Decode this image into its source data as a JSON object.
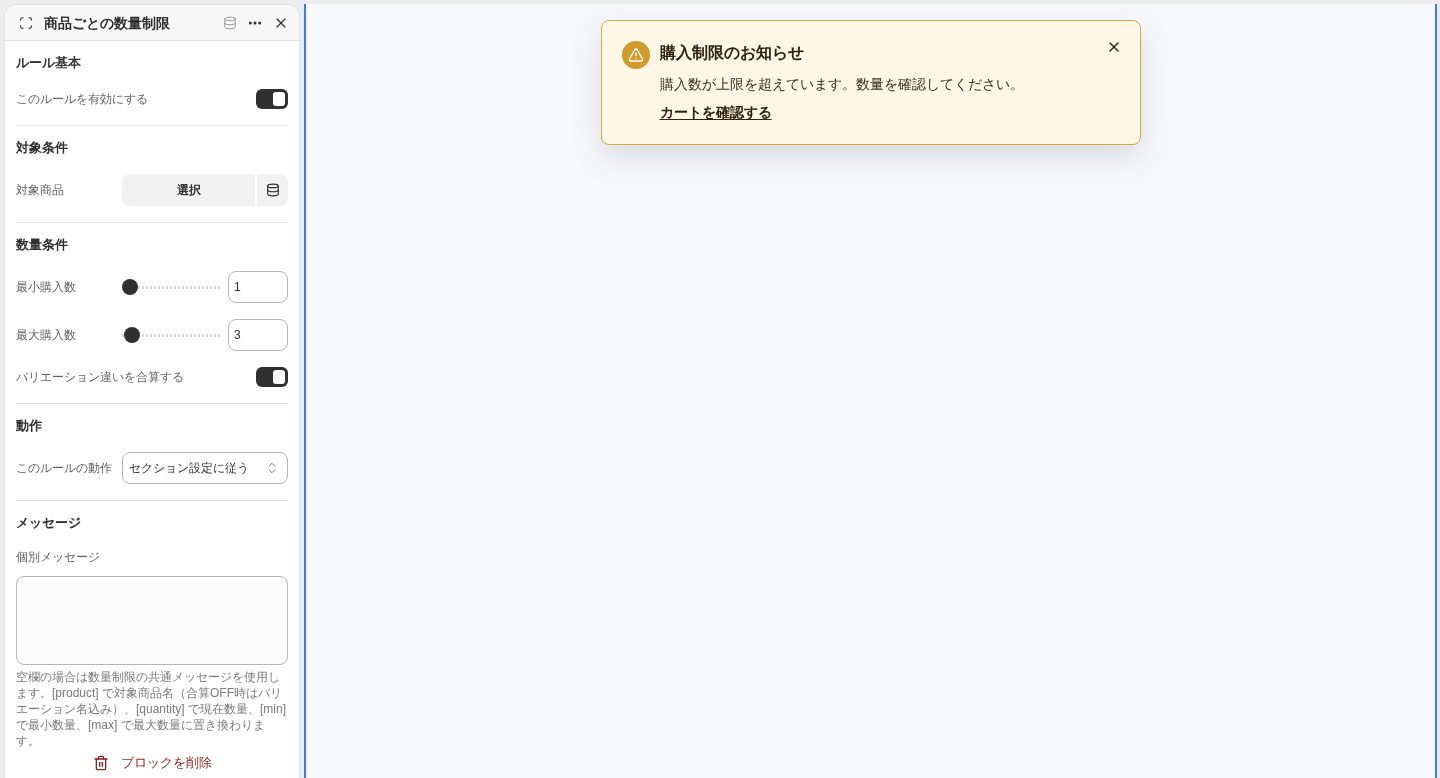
{
  "panel": {
    "title": "商品ごとの数量制限",
    "sections": [
      {
        "heading": "ルール基本",
        "rows": [
          {
            "kind": "toggle",
            "label": "このルールを有効にする",
            "on": true
          }
        ]
      },
      {
        "heading": "対象条件",
        "rows": [
          {
            "kind": "picker",
            "label": "対象商品",
            "button": "選択"
          }
        ]
      },
      {
        "heading": "数量条件",
        "rows": [
          {
            "kind": "slider",
            "label": "最小購入数",
            "level": 0,
            "value": "1"
          },
          {
            "kind": "slider",
            "label": "最大購入数",
            "level": 0.02,
            "value": "3"
          },
          {
            "kind": "toggle",
            "label": "バリエーション違いを合算する",
            "on": true
          }
        ]
      },
      {
        "heading": "動作",
        "rows": [
          {
            "kind": "select",
            "label": "このルールの動作",
            "value": "セクション設定に従う"
          }
        ]
      },
      {
        "heading": "メッセージ",
        "rows": [
          {
            "kind": "textarea",
            "label": "個別メッセージ",
            "help": "空欄の場合は数量制限の共通メッセージを使用します。[product] で対象商品名（合算OFF時はバリエーション名込み）、[quantity] で現在数量、[min] で最小数量、[max] で最大数量に置き換わります。"
          }
        ]
      }
    ],
    "delete_button": "ブロックを削除"
  },
  "notification": {
    "title": "購入制限のお知らせ",
    "message": "購入数が上限を超えています。数量を確認してください。",
    "link": "カートを確認する"
  }
}
